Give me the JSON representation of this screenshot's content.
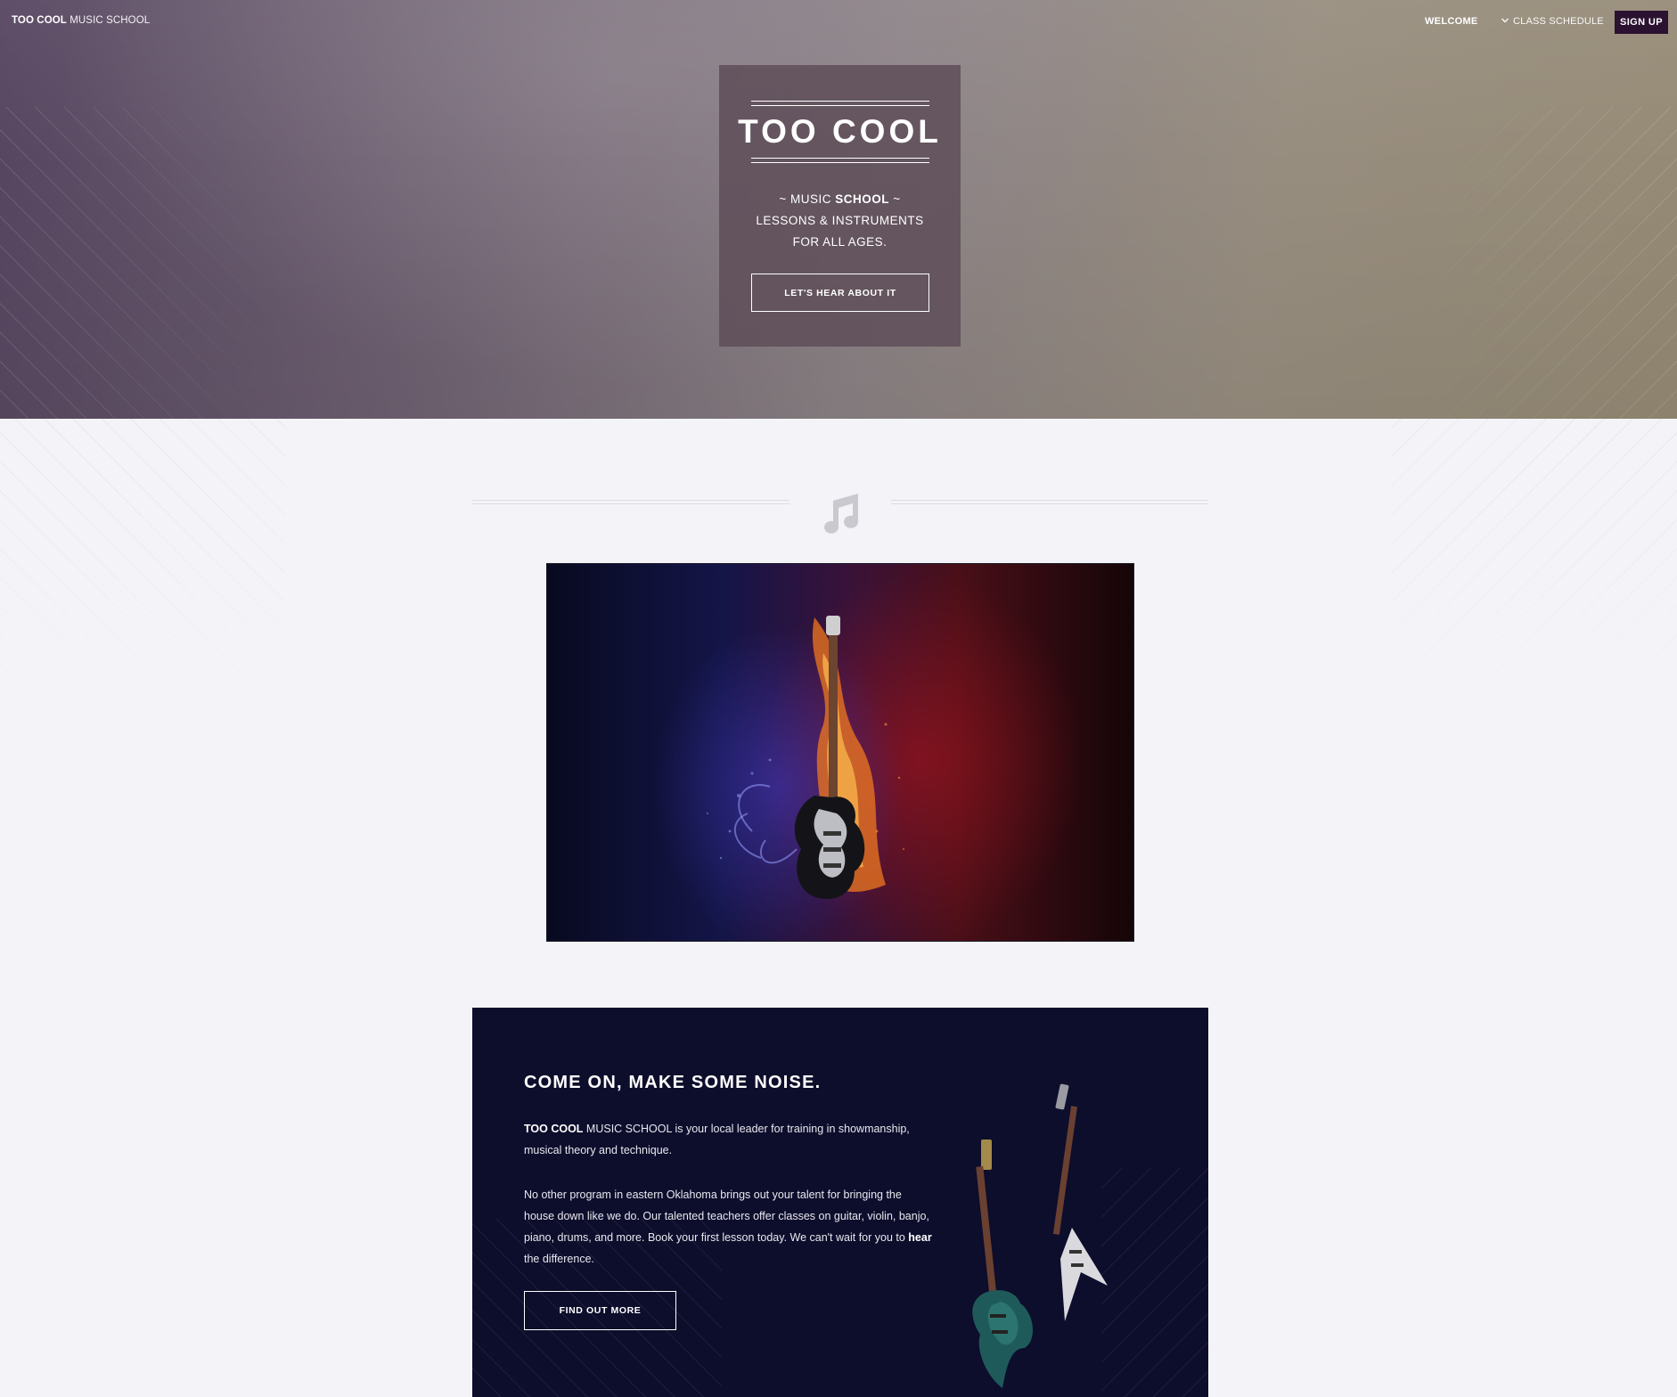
{
  "nav": {
    "brand_bold": "TOO COOL",
    "brand_light": "MUSIC SCHOOL",
    "welcome": "WELCOME",
    "class_schedule": "CLASS SCHEDULE",
    "sign_up": "SIGN UP"
  },
  "hero": {
    "title": "TOO COOL",
    "sub_line1_prefix": "~ MUSIC ",
    "sub_line1_bold": "SCHOOL",
    "sub_line1_suffix": " ~",
    "sub_line2": "LESSONS & INSTRUMENTS",
    "sub_line3": "FOR ALL AGES.",
    "cta": "LET'S HEAR ABOUT IT"
  },
  "feature": {
    "icon": "music-note-icon",
    "image": "guitar-fire-water-image"
  },
  "noise": {
    "title_prefix": "COME ON, MAKE SOME ",
    "title_bold": "NOISE.",
    "p1_bold": "TOO COOL",
    "p1_rest": " MUSIC SCHOOL is your local leader for training in showmanship, musical theory and technique.",
    "p2_prefix": "No other program in eastern Oklahoma brings out your talent for bringing the house down like we do. Our talented teachers offer classes on guitar, violin, banjo, piano, drums, and more. Book your first lesson today. We can't wait for you to ",
    "p2_bold": "hear",
    "p2_suffix": " the difference.",
    "cta": "FIND OUT MORE",
    "image": "electric-guitars-image"
  },
  "colors": {
    "signup_bg": "#2a1230",
    "panel_bg": "#0d0d2c",
    "page_bg": "#f4f4f8",
    "card_bg": "#5e4e58"
  }
}
